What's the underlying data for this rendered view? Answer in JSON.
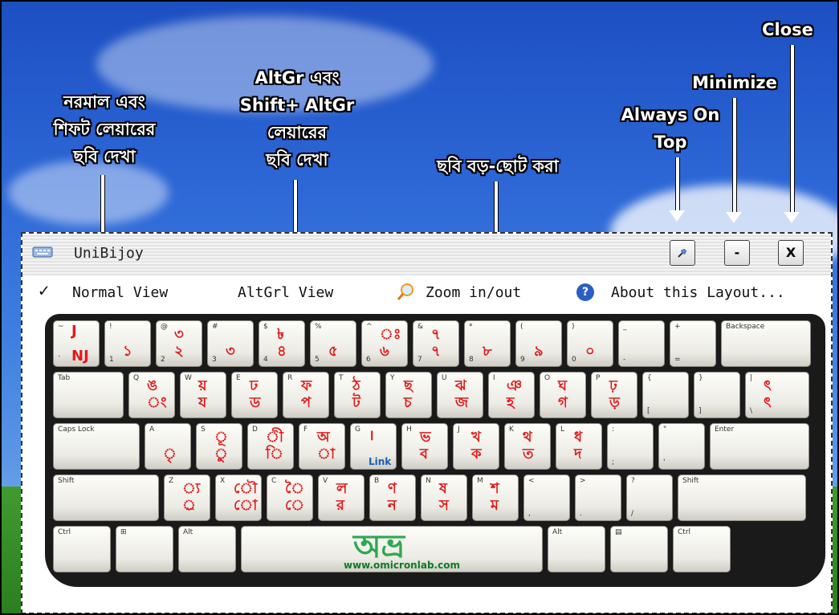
{
  "annotations": {
    "normal_layer": [
      "নরমাল এবং",
      "শিফট লেয়ারের",
      "ছবি দেখা"
    ],
    "altgr_layer": [
      "AltGr এবং",
      "Shift+ AltGr",
      "লেয়ারের",
      "ছবি দেখা"
    ],
    "zoom": "ছবি বড়-ছোট করা",
    "always_on_top": [
      "Always On",
      "Top"
    ],
    "minimize": "Minimize",
    "close": "Close"
  },
  "window": {
    "title": "UniBijoy",
    "buttons": {
      "pin_icon": "pin-icon",
      "minimize_label": "-",
      "close_label": "X"
    }
  },
  "menu": {
    "normal_view": "Normal View",
    "normal_check": "✓",
    "altgr_view": "AltGrl View",
    "zoom": "Zoom in/out",
    "about": "About this Layout...",
    "about_icon": "?"
  },
  "keyboard": {
    "rows": [
      [
        {
          "t": "~",
          "b": "`",
          "bt": "J",
          "bb": "NJ"
        },
        {
          "t": "!",
          "b": "1",
          "bt": "",
          "bb": "১"
        },
        {
          "t": "@",
          "b": "2",
          "bt": "৩",
          "bb": "২"
        },
        {
          "t": "#",
          "b": "3",
          "bt": "",
          "bb": "৩"
        },
        {
          "t": "$",
          "b": "4",
          "bt": "৳",
          "bb": "৪"
        },
        {
          "t": "%",
          "b": "5",
          "bt": "",
          "bb": "৫"
        },
        {
          "t": "^",
          "b": "6",
          "bt": "ঃ",
          "bb": "৬"
        },
        {
          "t": "&",
          "b": "7",
          "bt": "৭",
          "bb": "৭"
        },
        {
          "t": "*",
          "b": "8",
          "bt": "",
          "bb": "৮"
        },
        {
          "t": "(",
          "b": "9",
          "bt": "",
          "bb": "৯"
        },
        {
          "t": ")",
          "b": "0",
          "bt": "",
          "bb": "০"
        },
        {
          "t": "_",
          "b": "-",
          "bt": "",
          "bb": ""
        },
        {
          "t": "+",
          "b": "=",
          "bt": "",
          "bb": ""
        },
        {
          "t": "Backspace",
          "b": "",
          "bt": "",
          "bb": ""
        }
      ],
      [
        {
          "t": "Tab",
          "b": "",
          "bt": "",
          "bb": ""
        },
        {
          "t": "Q",
          "b": "",
          "bt": "ঙ",
          "bb": "ং"
        },
        {
          "t": "W",
          "b": "",
          "bt": "য়",
          "bb": "য"
        },
        {
          "t": "E",
          "b": "",
          "bt": "ঢ",
          "bb": "ড"
        },
        {
          "t": "R",
          "b": "",
          "bt": "ফ",
          "bb": "প"
        },
        {
          "t": "T",
          "b": "",
          "bt": "ঠ",
          "bb": "ট"
        },
        {
          "t": "Y",
          "b": "",
          "bt": "ছ",
          "bb": "চ"
        },
        {
          "t": "U",
          "b": "",
          "bt": "ঝ",
          "bb": "জ"
        },
        {
          "t": "I",
          "b": "",
          "bt": "ঞ",
          "bb": "হ"
        },
        {
          "t": "O",
          "b": "",
          "bt": "ঘ",
          "bb": "গ"
        },
        {
          "t": "P",
          "b": "",
          "bt": "ঢ়",
          "bb": "ড়"
        },
        {
          "t": "{",
          "b": "[",
          "bt": "",
          "bb": ""
        },
        {
          "t": "}",
          "b": "]",
          "bt": "",
          "bb": ""
        },
        {
          "t": "|",
          "b": "\\",
          "bt": "ৎ",
          "bb": "ৎ"
        }
      ],
      [
        {
          "t": "Caps Lock",
          "b": "",
          "bt": "",
          "bb": ""
        },
        {
          "t": "A",
          "b": "",
          "bt": "",
          "bb": "ৃ"
        },
        {
          "t": "S",
          "b": "",
          "bt": "ূ",
          "bb": "ু"
        },
        {
          "t": "D",
          "b": "",
          "bt": "ী",
          "bb": "ি"
        },
        {
          "t": "F",
          "b": "",
          "bt": "অ",
          "bb": "া"
        },
        {
          "t": "G",
          "b": "",
          "bt": "।",
          "bb": "Link"
        },
        {
          "t": "H",
          "b": "",
          "bt": "ভ",
          "bb": "ব"
        },
        {
          "t": "J",
          "b": "",
          "bt": "খ",
          "bb": "ক"
        },
        {
          "t": "K",
          "b": "",
          "bt": "থ",
          "bb": "ত"
        },
        {
          "t": "L",
          "b": "",
          "bt": "ধ",
          "bb": "দ"
        },
        {
          "t": ":",
          "b": ";",
          "bt": "",
          "bb": ""
        },
        {
          "t": "\"",
          "b": "'",
          "bt": "",
          "bb": ""
        },
        {
          "t": "Enter",
          "b": "",
          "bt": "",
          "bb": ""
        }
      ],
      [
        {
          "t": "Shift",
          "b": "",
          "bt": "",
          "bb": ""
        },
        {
          "t": "Z",
          "b": "",
          "bt": "্য",
          "bb": "্র"
        },
        {
          "t": "X",
          "b": "",
          "bt": "ৌ",
          "bb": "ো"
        },
        {
          "t": "C",
          "b": "",
          "bt": "ৈ",
          "bb": "ে"
        },
        {
          "t": "V",
          "b": "",
          "bt": "ল",
          "bb": "র"
        },
        {
          "t": "B",
          "b": "",
          "bt": "ণ",
          "bb": "ন"
        },
        {
          "t": "N",
          "b": "",
          "bt": "ষ",
          "bb": "স"
        },
        {
          "t": "M",
          "b": "",
          "bt": "শ",
          "bb": "ম"
        },
        {
          "t": "<",
          "b": ",",
          "bt": "",
          "bb": ""
        },
        {
          "t": ">",
          "b": ".",
          "bt": "",
          "bb": ""
        },
        {
          "t": "?",
          "b": "/",
          "bt": "",
          "bb": ""
        },
        {
          "t": "Shift",
          "b": "",
          "bt": "",
          "bb": ""
        }
      ],
      [
        {
          "t": "Ctrl",
          "b": "",
          "bt": "",
          "bb": ""
        },
        {
          "t": "⊞",
          "b": "",
          "bt": "",
          "bb": ""
        },
        {
          "t": "Alt",
          "b": "",
          "bt": "",
          "bb": ""
        },
        {
          "t": "",
          "b": "",
          "bt": "",
          "bb": ""
        },
        {
          "t": "Alt",
          "b": "",
          "bt": "",
          "bb": ""
        },
        {
          "t": "▤",
          "b": "",
          "bt": "",
          "bb": ""
        },
        {
          "t": "Ctrl",
          "b": "",
          "bt": "",
          "bb": ""
        }
      ]
    ],
    "logo": "অভ্র",
    "url": "www.omicronlab.com"
  }
}
